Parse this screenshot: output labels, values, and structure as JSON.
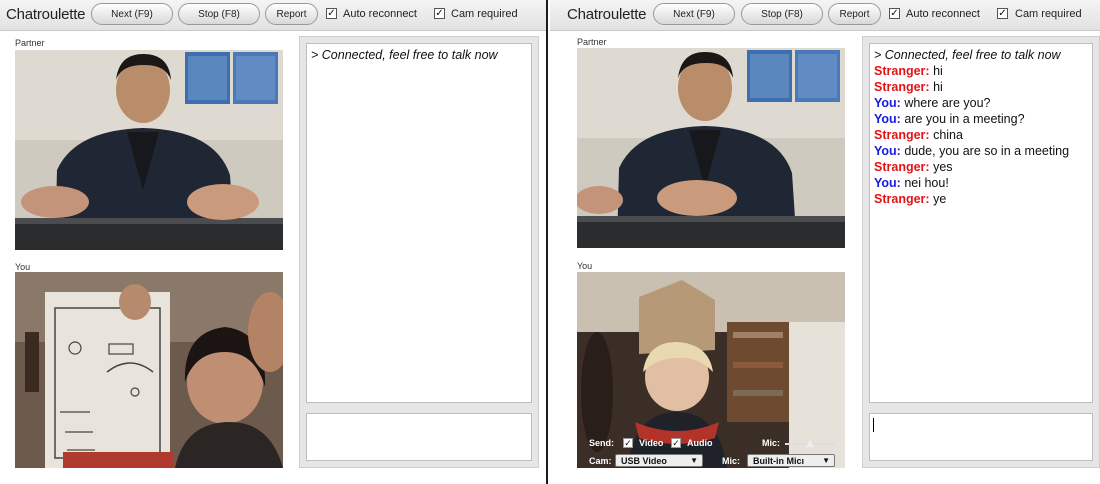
{
  "app": {
    "logo": "Chatroulette",
    "buttons": {
      "next": "Next (F9)",
      "stop": "Stop (F8)",
      "report": "Report"
    },
    "checkboxes": {
      "auto_reconnect": "Auto reconnect",
      "cam_required": "Cam required"
    },
    "check_mark": "✓"
  },
  "labels": {
    "partner": "Partner",
    "you": "You"
  },
  "left_chat": {
    "system": "> Connected, feel free to talk now"
  },
  "right_chat": {
    "system": "> Connected, feel free to talk now",
    "messages": [
      {
        "who": "Stranger:",
        "role": "stranger",
        "text": "hi"
      },
      {
        "who": "Stranger:",
        "role": "stranger",
        "text": "hi"
      },
      {
        "who": "You:",
        "role": "you",
        "text": "where are you?"
      },
      {
        "who": "You:",
        "role": "you",
        "text": "are you in a meeting?"
      },
      {
        "who": "Stranger:",
        "role": "stranger",
        "text": "china"
      },
      {
        "who": "You:",
        "role": "you",
        "text": "dude, you are so in a meeting"
      },
      {
        "who": "Stranger:",
        "role": "stranger",
        "text": "yes"
      },
      {
        "who": "You:",
        "role": "you",
        "text": "nei hou!"
      },
      {
        "who": "Stranger:",
        "role": "stranger",
        "text": "ye"
      }
    ]
  },
  "controls": {
    "send_label": "Send:",
    "video_label": "Video",
    "audio_label": "Audio",
    "mic_label": "Mic:",
    "mic_level": 0.5,
    "cam_label": "Cam:",
    "cam_select": "USB Video",
    "mic_select_label": "Mic:",
    "mic_select": "Built-in Micı",
    "dropdown_arrow": "▼"
  },
  "colors": {
    "stranger": "#e01515",
    "you": "#1a1ae0"
  }
}
